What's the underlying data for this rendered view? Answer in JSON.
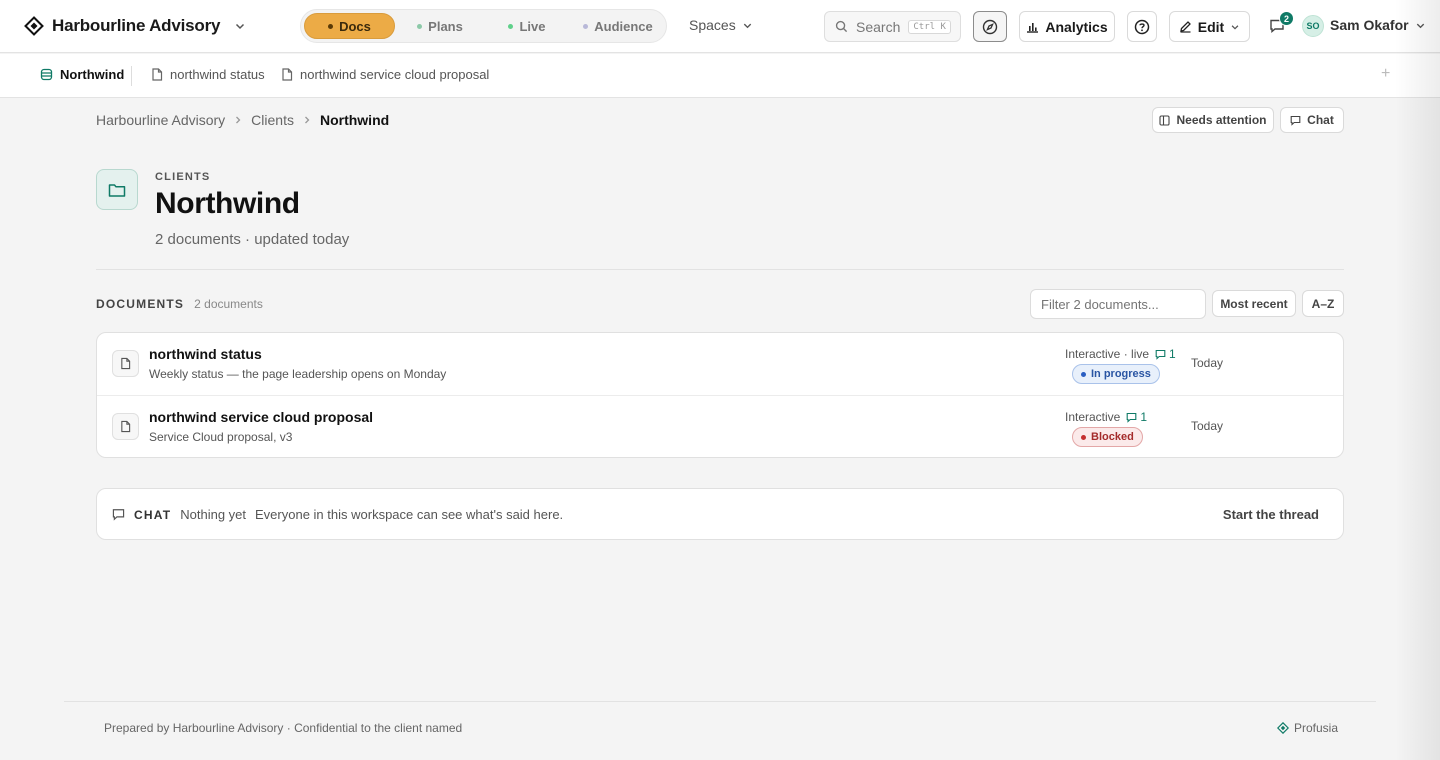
{
  "header": {
    "brand": "Harbourline Advisory",
    "modes": [
      {
        "label": "Docs",
        "dot_color": "#5a3a06"
      },
      {
        "label": "Plans",
        "dot_color": "#8cc9a8"
      },
      {
        "label": "Live",
        "dot_color": "#5fd08a"
      },
      {
        "label": "Audience",
        "dot_color": "#b8b8d8"
      }
    ],
    "spaces_label": "Spaces",
    "search_label": "Search",
    "search_kbd": "Ctrl K",
    "analytics_label": "Analytics",
    "edit_label": "Edit",
    "notifications_count": "2",
    "avatar_initials": "SO",
    "user_name": "Sam Okafor"
  },
  "tabs": [
    {
      "label": "Northwind",
      "icon": "database-icon"
    },
    {
      "label": "northwind status",
      "icon": "file-icon"
    },
    {
      "label": "northwind service cloud proposal",
      "icon": "file-icon"
    }
  ],
  "breadcrumb": {
    "items": [
      "Harbourline Advisory",
      "Clients",
      "Northwind"
    ]
  },
  "actions": {
    "needs_attention": "Needs attention",
    "chat": "Chat"
  },
  "page": {
    "eyebrow": "CLIENTS",
    "title": "Northwind",
    "subtitle": "2 documents · updated today"
  },
  "documents": {
    "heading": "DOCUMENTS",
    "count": "2 documents",
    "filter_placeholder": "Filter 2 documents...",
    "sort_recent": "Most recent",
    "sort_az": "A–Z",
    "rows": [
      {
        "title": "northwind status",
        "description": "Weekly status — the page leadership opens on Monday",
        "kind": "Interactive · live",
        "comments": "1",
        "status": "In progress",
        "date": "Today"
      },
      {
        "title": "northwind service cloud proposal",
        "description": "Service Cloud proposal, v3",
        "kind": "Interactive",
        "comments": "1",
        "status": "Blocked",
        "date": "Today"
      }
    ]
  },
  "chat": {
    "heading": "CHAT",
    "empty": "Nothing yet",
    "note": "Everyone in this workspace can see what's said here.",
    "start": "Start the thread"
  },
  "footer": {
    "left": "Prepared by Harbourline Advisory · Confidential to the client named",
    "right": "Profusia"
  },
  "colors": {
    "accent": "#ecab46",
    "brand_green": "#0f7a66",
    "in_progress": "#2a5ec2",
    "blocked": "#c53030"
  }
}
